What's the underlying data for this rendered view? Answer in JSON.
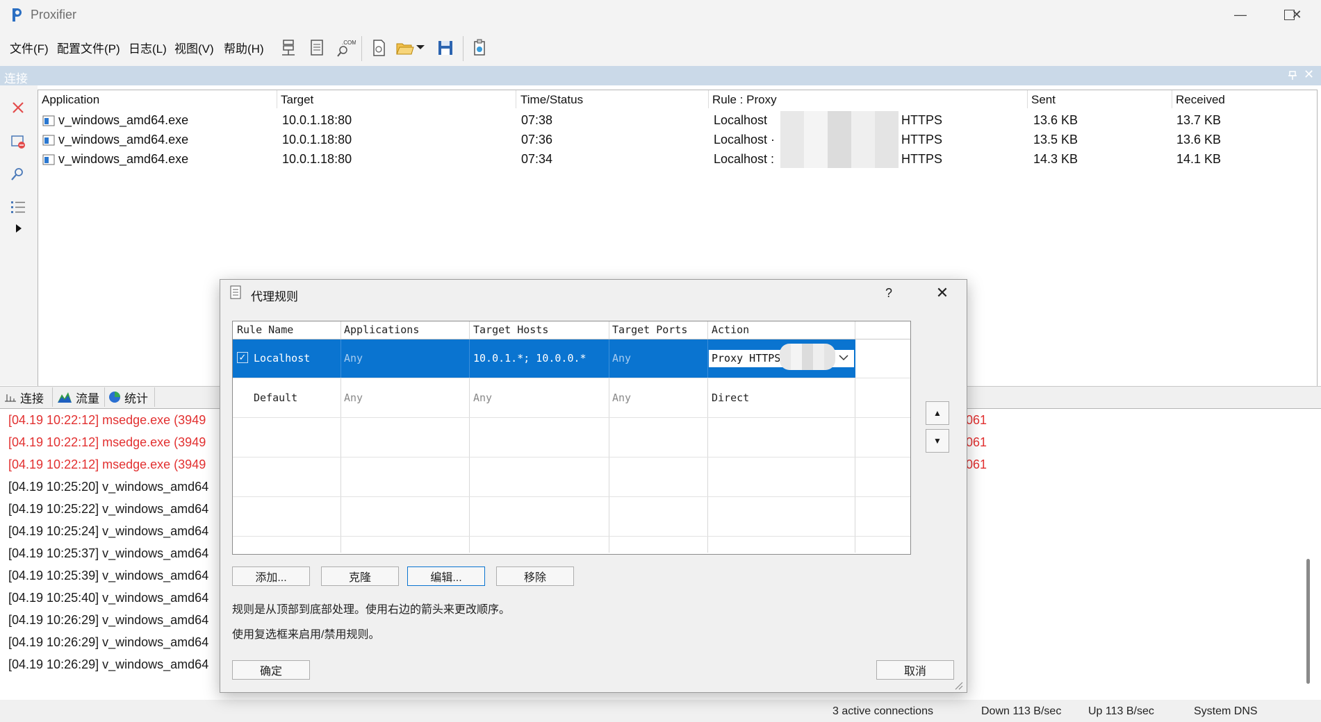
{
  "window": {
    "title": "Proxifier",
    "minimize": "—",
    "maximize": "☐",
    "close": "✕"
  },
  "menu": [
    "文件(F)",
    "配置文件(P)",
    "日志(L)",
    "视图(V)",
    "帮助(H)"
  ],
  "panel": {
    "title": "连接"
  },
  "connections": {
    "headers": [
      "Application",
      "Target",
      "Time/Status",
      "Rule : Proxy",
      "Sent",
      "Received"
    ],
    "rows": [
      {
        "app": "v_windows_amd64.exe",
        "target": "10.0.1.18:80",
        "time": "07:38",
        "rule": "Localhost",
        "proxy_tail": "HTTPS",
        "sent": "13.6 KB",
        "received": "13.7 KB"
      },
      {
        "app": "v_windows_amd64.exe",
        "target": "10.0.1.18:80",
        "time": "07:36",
        "rule": "Localhost ·",
        "proxy_tail": "HTTPS",
        "sent": "13.5 KB",
        "received": "13.6 KB"
      },
      {
        "app": "v_windows_amd64.exe",
        "target": "10.0.1.18:80",
        "time": "07:34",
        "rule": "Localhost :",
        "proxy_tail": "HTTPS",
        "sent": "14.3 KB",
        "received": "14.1 KB"
      }
    ]
  },
  "tabs": [
    "连接",
    "流量",
    "统计"
  ],
  "log": [
    {
      "left": "[04.19 10:22:12] msedge.exe (3949",
      "right": "061",
      "error": true
    },
    {
      "left": "[04.19 10:22:12] msedge.exe (3949",
      "right": "061",
      "error": true
    },
    {
      "left": "[04.19 10:22:12] msedge.exe (3949",
      "right": "061",
      "error": true
    },
    {
      "left": "[04.19 10:25:20] v_windows_amd64",
      "right": "",
      "error": false
    },
    {
      "left": "[04.19 10:25:22] v_windows_amd64",
      "right": "",
      "error": false
    },
    {
      "left": "[04.19 10:25:24] v_windows_amd64",
      "right": "",
      "error": false
    },
    {
      "left": "[04.19 10:25:37] v_windows_amd64",
      "right": "",
      "error": false
    },
    {
      "left": "[04.19 10:25:39] v_windows_amd64",
      "right": "",
      "error": false
    },
    {
      "left": "[04.19 10:25:40] v_windows_amd64",
      "right": "",
      "error": false
    },
    {
      "left": "[04.19 10:26:29] v_windows_amd64",
      "right": "",
      "error": false
    },
    {
      "left": "[04.19 10:26:29] v_windows_amd64",
      "right": "",
      "error": false
    },
    {
      "left": "[04.19 10:26:29] v_windows_amd64",
      "right": "",
      "error": false
    }
  ],
  "status": {
    "connections": "3 active connections",
    "down": "Down 113 B/sec",
    "up": "Up 113 B/sec",
    "dns": "System DNS"
  },
  "dialog": {
    "title": "代理规则",
    "help": "?",
    "close": "✕",
    "headers": [
      "Rule Name",
      "Applications",
      "Target Hosts",
      "Target Ports",
      "Action"
    ],
    "rules": [
      {
        "name": "Localhost",
        "checked": true,
        "apps": "Any",
        "hosts": "10.0.1.*; 10.0.0.*",
        "ports": "Any",
        "action": "Proxy HTTPS"
      },
      {
        "name": "Default",
        "checked": false,
        "apps": "Any",
        "hosts": "Any",
        "ports": "Any",
        "action": "Direct"
      }
    ],
    "buttons": {
      "add": "添加...",
      "clone": "克隆",
      "edit": "编辑...",
      "remove": "移除",
      "ok": "确定",
      "cancel": "取消"
    },
    "hint1": "规则是从顶部到底部处理。使用右边的箭头来更改顺序。",
    "hint2": "使用复选框来启用/禁用规则。",
    "up_arrow": "▲",
    "down_arrow": "▼"
  },
  "colors": {
    "accent": "#0a74d0",
    "error": "#e23030",
    "panel_header": "#cad9e8"
  }
}
